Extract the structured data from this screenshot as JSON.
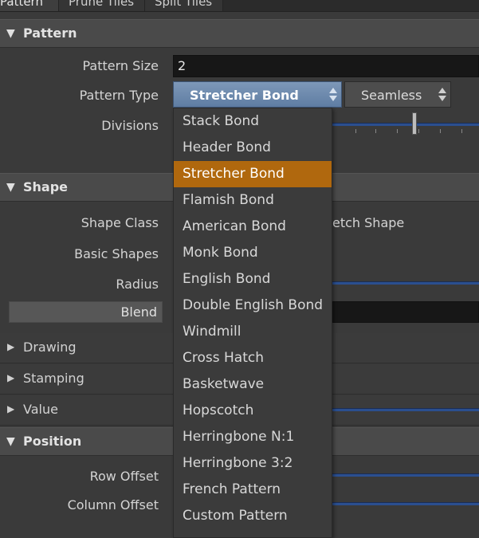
{
  "tabs": [
    "Pattern",
    "Prune Tiles",
    "Split Tiles"
  ],
  "sections": {
    "pattern": "Pattern",
    "shape": "Shape",
    "drawing": "Drawing",
    "stamping": "Stamping",
    "value": "Value",
    "position": "Position"
  },
  "pattern": {
    "size_label": "Pattern Size",
    "size_value": "2",
    "type_label": "Pattern Type",
    "type_value": "Stretcher Bond",
    "seamless_value": "Seamless",
    "divisions_label": "Divisions"
  },
  "shape": {
    "class_label": "Shape Class",
    "class_value_partial": "etch Shape",
    "basic_label": "Basic Shapes",
    "radius_label": "Radius",
    "blend_label": "Blend"
  },
  "position": {
    "row_offset_label": "Row Offset",
    "column_offset_label": "Column Offset"
  },
  "dropdown": {
    "options": [
      "Stack Bond",
      "Header Bond",
      "Stretcher Bond",
      "Flamish Bond",
      "American Bond",
      "Monk Bond",
      "English Bond",
      "Double English Bond",
      "Windmill",
      "Cross Hatch",
      "Basketwave",
      "Hopscotch",
      "Herringbone N:1",
      "Herringbone 3:2",
      "French Pattern",
      "Custom Pattern"
    ],
    "highlighted": "Stretcher Bond"
  },
  "colors": {
    "background": "#3a3a3a",
    "highlight": "#b0680e",
    "selected_combo": "#6f8bb0",
    "slider": "#2b4f8f"
  }
}
